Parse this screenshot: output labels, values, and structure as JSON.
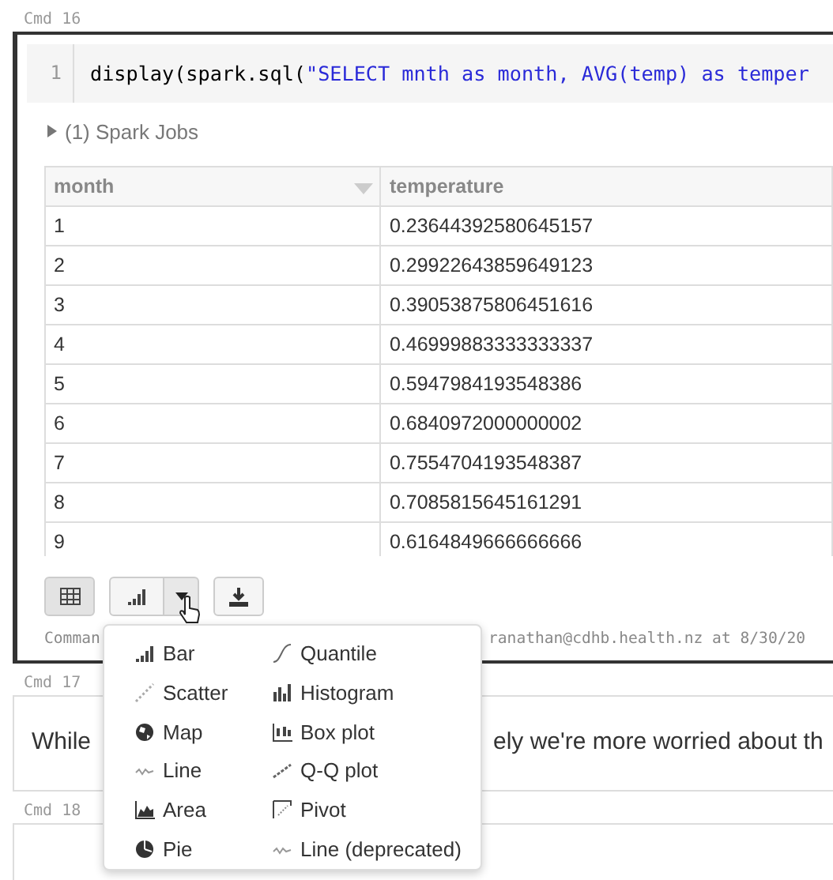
{
  "cells": [
    {
      "label": "Cmd 16",
      "kind": "code",
      "selected": true,
      "code": {
        "line_number": "1",
        "text": "display(spark.sql(",
        "string": "\"SELECT mnth as month, AVG(temp) as temper"
      },
      "spark_jobs": {
        "label": "(1) Spark Jobs",
        "expanded": false
      },
      "table": {
        "columns": [
          {
            "label": "month",
            "sortable": true
          },
          {
            "label": "temperature",
            "sortable": false
          }
        ],
        "rows": [
          [
            "1",
            "0.23644392580645157"
          ],
          [
            "2",
            "0.29922643859649123"
          ],
          [
            "3",
            "0.39053875806451616"
          ],
          [
            "4",
            "0.46999883333333337"
          ],
          [
            "5",
            "0.5947984193548386"
          ],
          [
            "6",
            "0.6840972000000002"
          ],
          [
            "7",
            "0.7554704193548387"
          ],
          [
            "8",
            "0.7085815645161291"
          ],
          [
            "9",
            "0.6164849666666666"
          ]
        ]
      },
      "view_buttons": [
        {
          "kind": "table",
          "selected": true
        },
        {
          "kind": "chart",
          "selected": false
        },
        {
          "kind": "download",
          "selected": false
        }
      ],
      "footer": [
        "Comman",
        "ranathan@cdhb.health.nz at 8/30/20"
      ]
    },
    {
      "label": "Cmd 17",
      "kind": "markdown",
      "selected": false,
      "text": [
        "While",
        "ely we're more worried about th"
      ]
    },
    {
      "label": "Cmd 18",
      "kind": "markdown",
      "selected": false,
      "text": []
    }
  ],
  "chart_menu": {
    "columns": [
      [
        {
          "kind": "bar",
          "label": "Bar"
        },
        {
          "kind": "scatter",
          "label": "Scatter"
        },
        {
          "kind": "map",
          "label": "Map"
        },
        {
          "kind": "line",
          "label": "Line"
        },
        {
          "kind": "area",
          "label": "Area"
        },
        {
          "kind": "pie",
          "label": "Pie"
        }
      ],
      [
        {
          "kind": "quantile",
          "label": "Quantile"
        },
        {
          "kind": "histogram",
          "label": "Histogram"
        },
        {
          "kind": "boxplot",
          "label": "Box plot"
        },
        {
          "kind": "qq",
          "label": "Q-Q plot"
        },
        {
          "kind": "pivot",
          "label": "Pivot"
        },
        {
          "kind": "line",
          "label": "Line (deprecated)"
        }
      ]
    ]
  }
}
